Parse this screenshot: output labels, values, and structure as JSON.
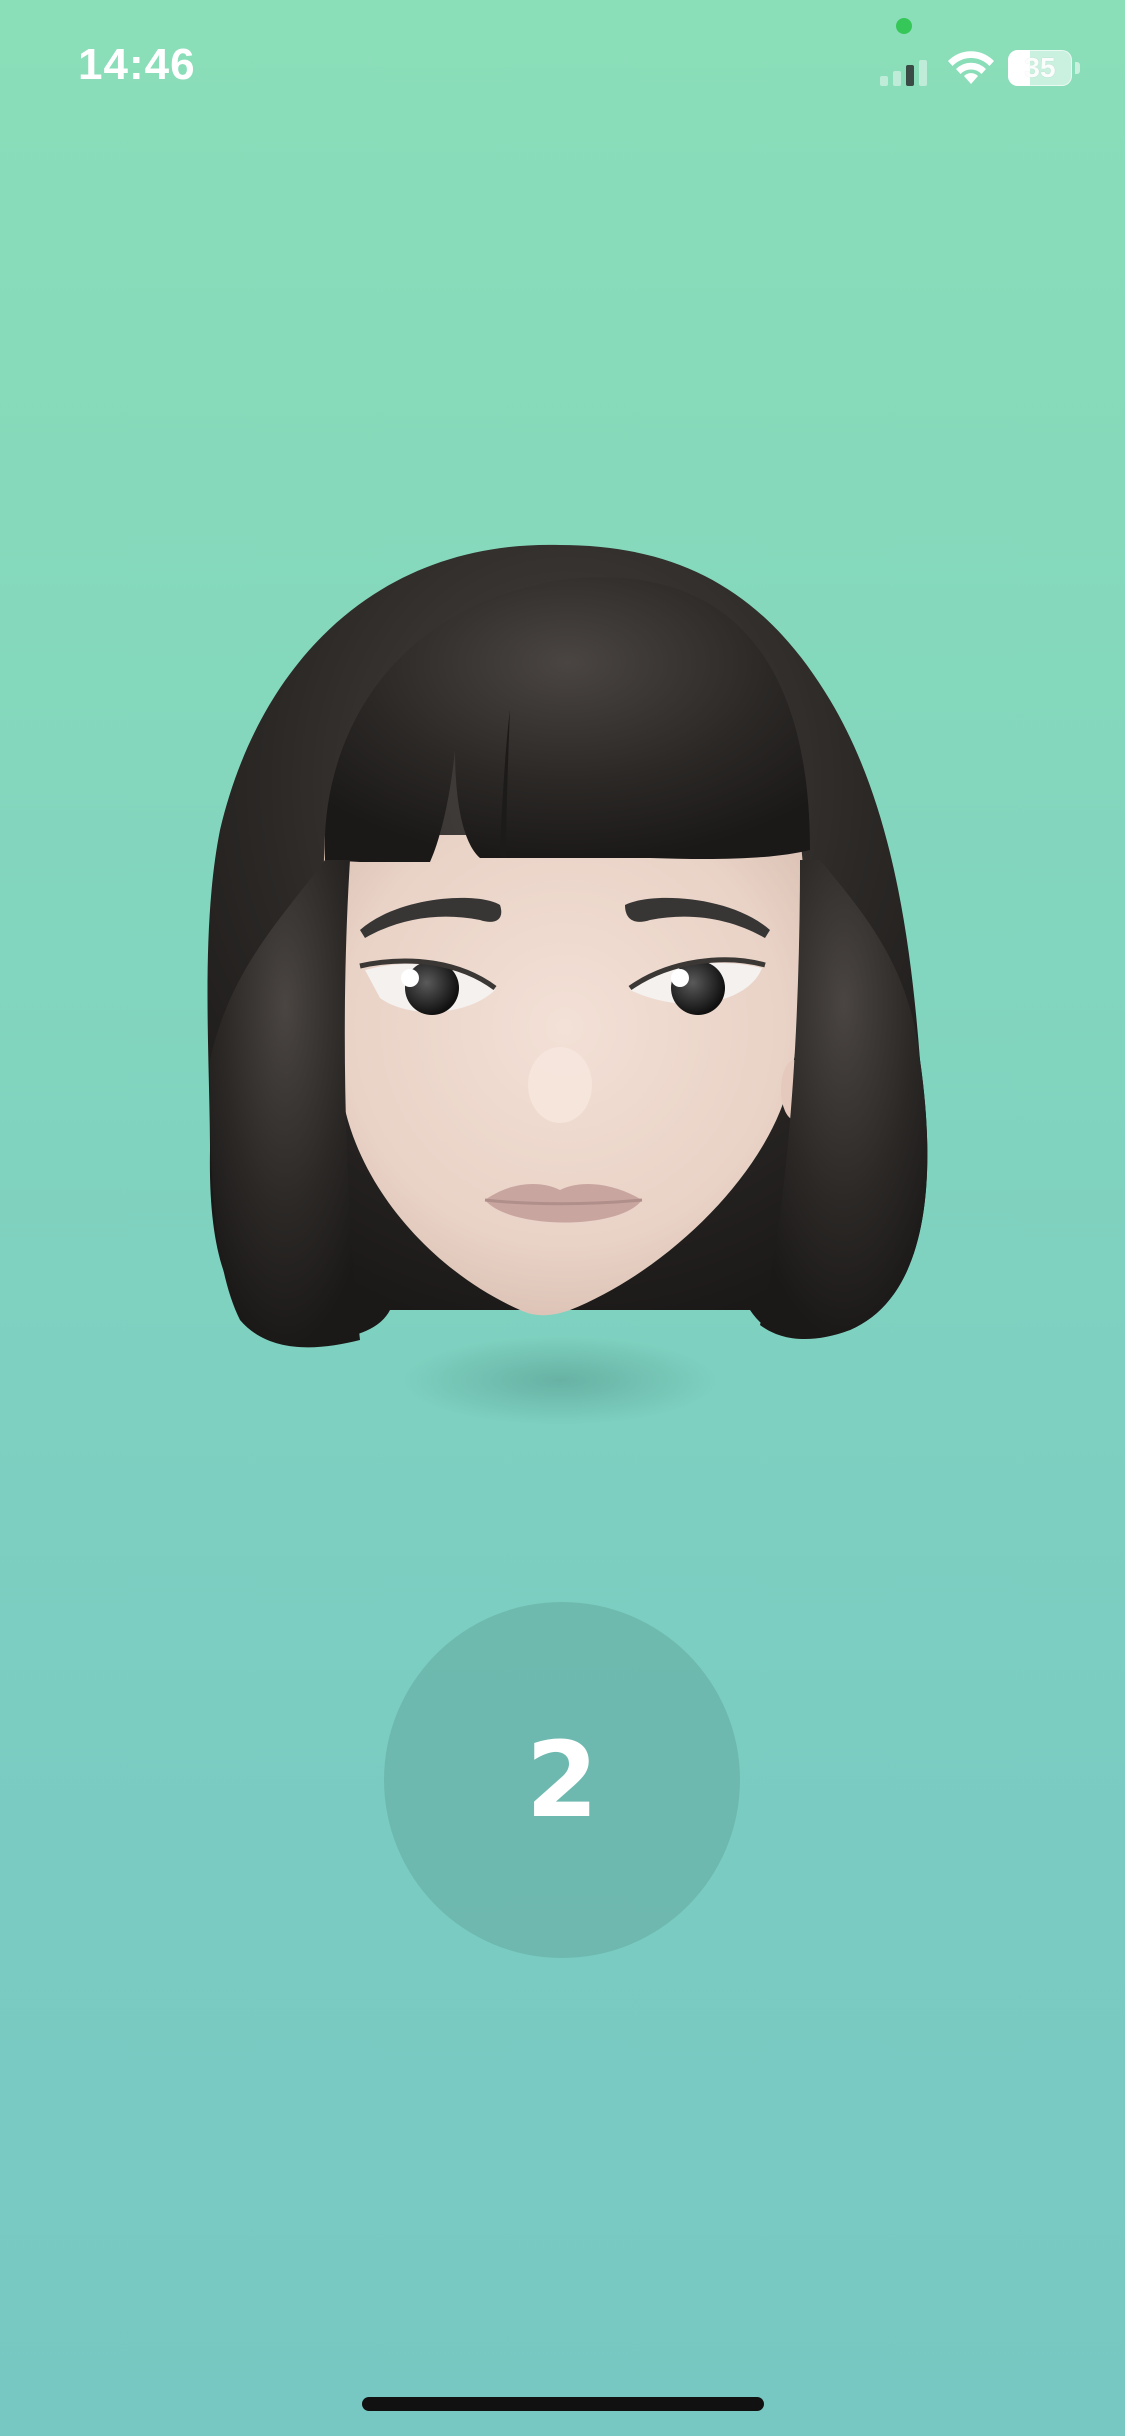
{
  "status_bar": {
    "time": "14:46",
    "battery_percent": "35",
    "icons": [
      "camera-indicator-dot",
      "cellular-signal-icon",
      "wifi-icon",
      "battery-icon"
    ]
  },
  "avatar": {
    "icon": "memoji-avatar-face",
    "colors": {
      "hair": "#2B2826",
      "skin": "#EED7CB",
      "lips": "#C9A5A0"
    }
  },
  "countdown": {
    "value": "2"
  },
  "colors": {
    "background_top": "#8ADEB8",
    "background_bottom": "#77C8C2",
    "countdown_circle": "#6FB9AB"
  }
}
